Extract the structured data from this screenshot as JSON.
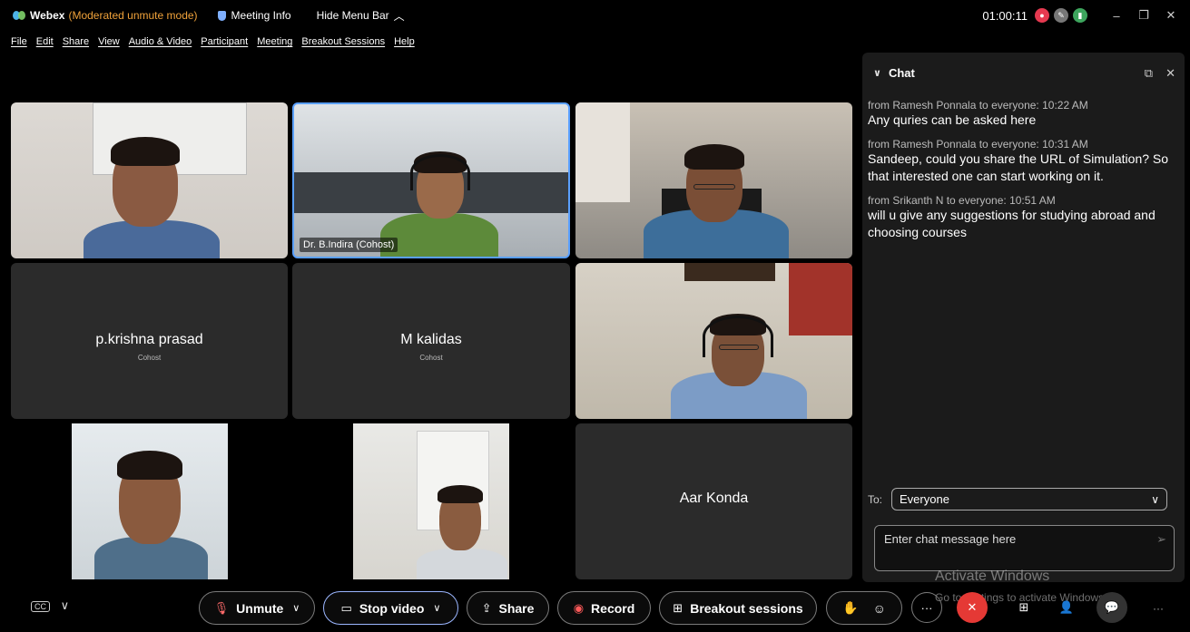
{
  "titlebar": {
    "app_name": "Webex",
    "mode": "(Moderated unmute mode)",
    "meeting_info": "Meeting Info",
    "hide_menu": "Hide Menu Bar",
    "timer": "01:00:11"
  },
  "menu": [
    "File",
    "Edit",
    "Share",
    "View",
    "Audio & Video",
    "Participant",
    "Meeting",
    "Breakout Sessions",
    "Help"
  ],
  "tiles": {
    "t2_label": "Dr. B.Indira (Cohost)",
    "t4_name": "p.krishna prasad",
    "t4_role": "Cohost",
    "t5_name": "M kalidas",
    "t5_role": "Cohost",
    "t9_name": "Aar Konda"
  },
  "chat": {
    "title": "Chat",
    "messages": [
      {
        "meta": "from Ramesh Ponnala to everyone:   10:22 AM",
        "text": "Any quries can be asked here"
      },
      {
        "meta": "from Ramesh Ponnala to everyone:   10:31 AM",
        "text": "Sandeep, could you share the URL of Simulation? So that interested one can start working on it."
      },
      {
        "meta": "from Srikanth N to everyone:   10:51 AM",
        "text": "will u give any suggestions for studying abroad and choosing courses"
      }
    ],
    "to_label": "To:",
    "to_value": "Everyone",
    "placeholder": "Enter chat message here"
  },
  "watermark": {
    "line1": "Activate Windows",
    "line2": "Go to Settings to activate Windows."
  },
  "toolbar": {
    "unmute": "Unmute",
    "stop_video": "Stop video",
    "share": "Share",
    "record": "Record",
    "breakout": "Breakout sessions"
  },
  "colors": {
    "accent_blue": "#5aa0ff",
    "mode_orange": "#f0a23a",
    "end_red": "#e53935"
  }
}
